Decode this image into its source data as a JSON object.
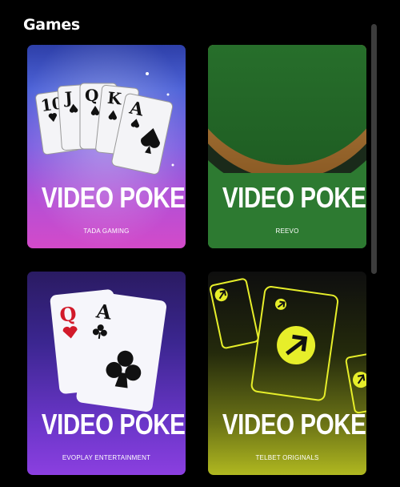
{
  "section": {
    "title": "Games"
  },
  "games": [
    {
      "name": "VIDEO POKER",
      "provider": "TADA GAMING"
    },
    {
      "name": "VIDEO POKER",
      "provider": "REEVO"
    },
    {
      "name": "VIDEO POKER",
      "provider": "EVOPLAY ENTERTAINMENT"
    },
    {
      "name": "VIDEO POKER",
      "provider": "TELBET ORIGINALS"
    }
  ],
  "artwork": {
    "tile1_cards": [
      "10",
      "J",
      "Q",
      "K",
      "A"
    ],
    "tile3_cards": [
      "Q",
      "A"
    ]
  },
  "colors": {
    "background": "#000000",
    "accent_yellow": "#e6ee2a",
    "felt_green": "#2d7a31"
  }
}
